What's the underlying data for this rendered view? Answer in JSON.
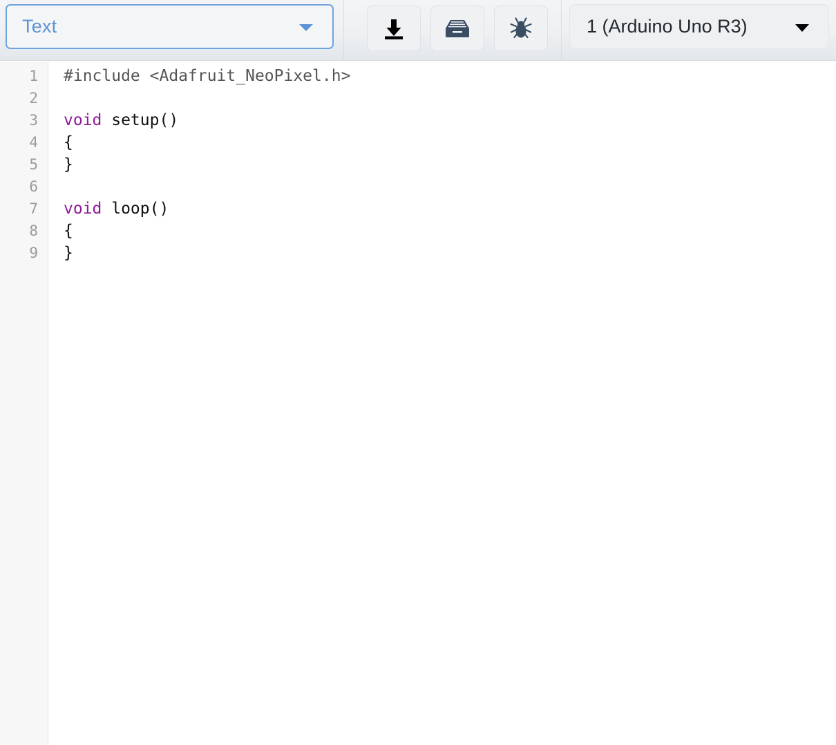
{
  "toolbar": {
    "mode_select": {
      "value": "Text",
      "icon": "chevron-down-icon"
    },
    "buttons": [
      {
        "name": "download-button",
        "icon": "download-icon",
        "label": "Download"
      },
      {
        "name": "archive-button",
        "icon": "archive-box-icon",
        "label": "Archive"
      },
      {
        "name": "debug-button",
        "icon": "bug-icon",
        "label": "Debug"
      }
    ],
    "board_select": {
      "value": "1 (Arduino Uno R3)",
      "icon": "chevron-down-icon"
    },
    "colors": {
      "accent_blue": "#5b93d6",
      "icon_slate": "#3a4d63",
      "toolbar_bg": "#eef0f2",
      "separator": "#dadee2"
    }
  },
  "editor": {
    "gutter_numbers": [
      "1",
      "2",
      "3",
      "4",
      "5",
      "6",
      "7",
      "8",
      "9"
    ],
    "lines": [
      {
        "n": "1",
        "tokens": [
          {
            "t": "#include <Adafruit_NeoPixel.h>",
            "c": "pre"
          }
        ]
      },
      {
        "n": "2",
        "tokens": [
          {
            "t": "",
            "c": "txt"
          }
        ]
      },
      {
        "n": "3",
        "tokens": [
          {
            "t": "void",
            "c": "kw"
          },
          {
            "t": " setup()",
            "c": "txt"
          }
        ]
      },
      {
        "n": "4",
        "tokens": [
          {
            "t": "{",
            "c": "txt"
          }
        ]
      },
      {
        "n": "5",
        "tokens": [
          {
            "t": "}",
            "c": "txt"
          }
        ]
      },
      {
        "n": "6",
        "tokens": [
          {
            "t": "",
            "c": "txt"
          }
        ]
      },
      {
        "n": "7",
        "tokens": [
          {
            "t": "void",
            "c": "kw"
          },
          {
            "t": " loop()",
            "c": "txt"
          }
        ]
      },
      {
        "n": "8",
        "tokens": [
          {
            "t": "{",
            "c": "txt"
          }
        ]
      },
      {
        "n": "9",
        "tokens": [
          {
            "t": "}",
            "c": "txt"
          }
        ]
      }
    ],
    "colors": {
      "preprocessor": "#555555",
      "keyword": "#8e1a95",
      "text": "#111111",
      "line_number": "#9a9a9a",
      "gutter_bg": "#f7f7f7",
      "code_bg": "#ffffff"
    }
  }
}
